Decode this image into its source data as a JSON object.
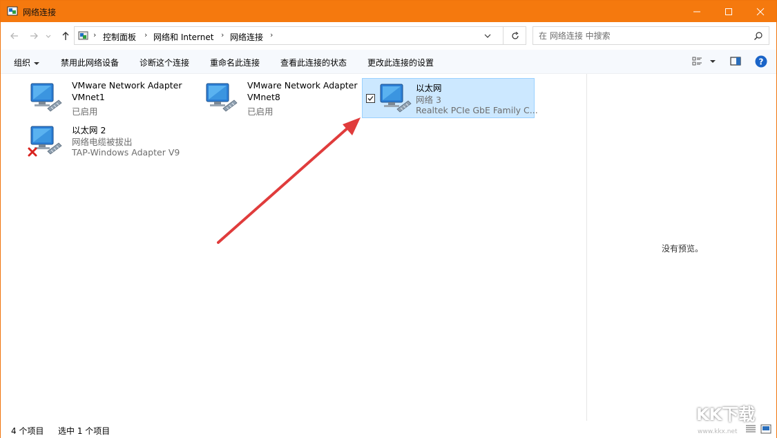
{
  "window": {
    "title": "网络连接"
  },
  "address": {
    "crumbs": [
      "控制面板",
      "网络和 Internet",
      "网络连接"
    ],
    "search_placeholder": "在 网络连接 中搜索"
  },
  "toolbar": {
    "organize": "组织",
    "disable": "禁用此网络设备",
    "diagnose": "诊断这个连接",
    "rename": "重命名此连接",
    "view_status": "查看此连接的状态",
    "change_settings": "更改此连接的设置"
  },
  "items": [
    {
      "name": "VMware Network Adapter",
      "name2": "VMnet1",
      "status": "已启用",
      "selected": false,
      "disconnected": false
    },
    {
      "name": "VMware Network Adapter",
      "name2": "VMnet8",
      "status": "已启用",
      "selected": false,
      "disconnected": false
    },
    {
      "name": "以太网",
      "status": "网络 3",
      "device": "Realtek PCIe GbE Family C...",
      "selected": true,
      "disconnected": false
    },
    {
      "name": "以太网 2",
      "status": "网络电缆被拔出",
      "device": "TAP-Windows Adapter V9",
      "selected": false,
      "disconnected": true
    }
  ],
  "preview": {
    "text": "没有预览。"
  },
  "statusbar": {
    "count": "4 个项目",
    "selected": "选中 1 个项目"
  },
  "watermark": {
    "text": "KK下载",
    "url": "www.kkx.net"
  },
  "colors": {
    "titlebar": "#f5790e",
    "selection": "#cce8ff",
    "arrow": "#e03c3c"
  },
  "icons": [
    "back-arrow-icon",
    "forward-arrow-icon",
    "up-arrow-icon",
    "refresh-icon",
    "search-icon",
    "help-icon",
    "network-adapter-icon",
    "disconnected-x-icon"
  ]
}
